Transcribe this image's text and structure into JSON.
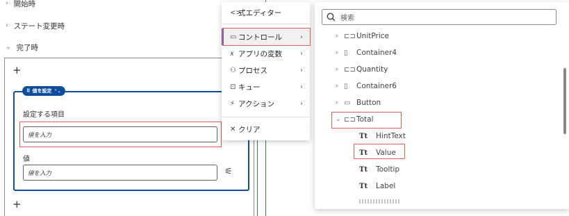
{
  "left": {
    "rows": [
      {
        "chevron": "›",
        "label": "開始時"
      },
      {
        "chevron": "›",
        "label": "ステート変更時"
      },
      {
        "chevron": "⌄",
        "label": "完了時"
      }
    ],
    "plus": "+",
    "pill_label": "値を設定",
    "pill_icon": "⠿",
    "pill_expand": "⌃⌄",
    "item_label": "設定する項目",
    "item_placeholder": "値を入力",
    "value_label": "値",
    "value_placeholder": "値を入力",
    "settings_icon": "⚟",
    "plus_bottom": "+"
  },
  "menu": {
    "items": [
      {
        "icon": "<>",
        "label": "式エディター",
        "arrow": ""
      },
      {
        "icon": "▭",
        "label": "コントロール",
        "arrow": "›"
      },
      {
        "icon": "𝑥",
        "label": "アプリの変数",
        "arrow": "›"
      },
      {
        "icon": "⚇",
        "label": "プロセス",
        "arrow": "›"
      },
      {
        "icon": "⊡",
        "label": "キュー",
        "arrow": "›"
      },
      {
        "icon": "⚡",
        "label": "アクション",
        "arrow": "›"
      },
      {
        "icon": "✕",
        "label": "クリア",
        "arrow": ""
      }
    ]
  },
  "tree": {
    "search_placeholder": "検索",
    "items": [
      {
        "chevron": "›",
        "icon": "⊏⊐",
        "label": "UnitPrice"
      },
      {
        "chevron": "›",
        "icon": "▯",
        "label": "Container4"
      },
      {
        "chevron": "›",
        "icon": "⊏⊐",
        "label": "Quantity"
      },
      {
        "chevron": "›",
        "icon": "▯",
        "label": "Container6"
      },
      {
        "chevron": "›",
        "icon": "▭",
        "label": "Button"
      },
      {
        "chevron": "⌄",
        "icon": "⊏⊐",
        "label": "Total"
      },
      {
        "chevron": "",
        "icon": "Tt",
        "label": "HintText"
      },
      {
        "chevron": "",
        "icon": "Tt",
        "label": "Value"
      },
      {
        "chevron": "",
        "icon": "Tt",
        "label": "Tooltip"
      },
      {
        "chevron": "",
        "icon": "Tt",
        "label": "Label"
      }
    ]
  },
  "colors": {
    "accent": "#5b5fc7",
    "highlight": "#e15a5a",
    "pill": "#0f4c9e",
    "panel_border": "#0f4c9e",
    "green_line": "#2e8b2e"
  }
}
